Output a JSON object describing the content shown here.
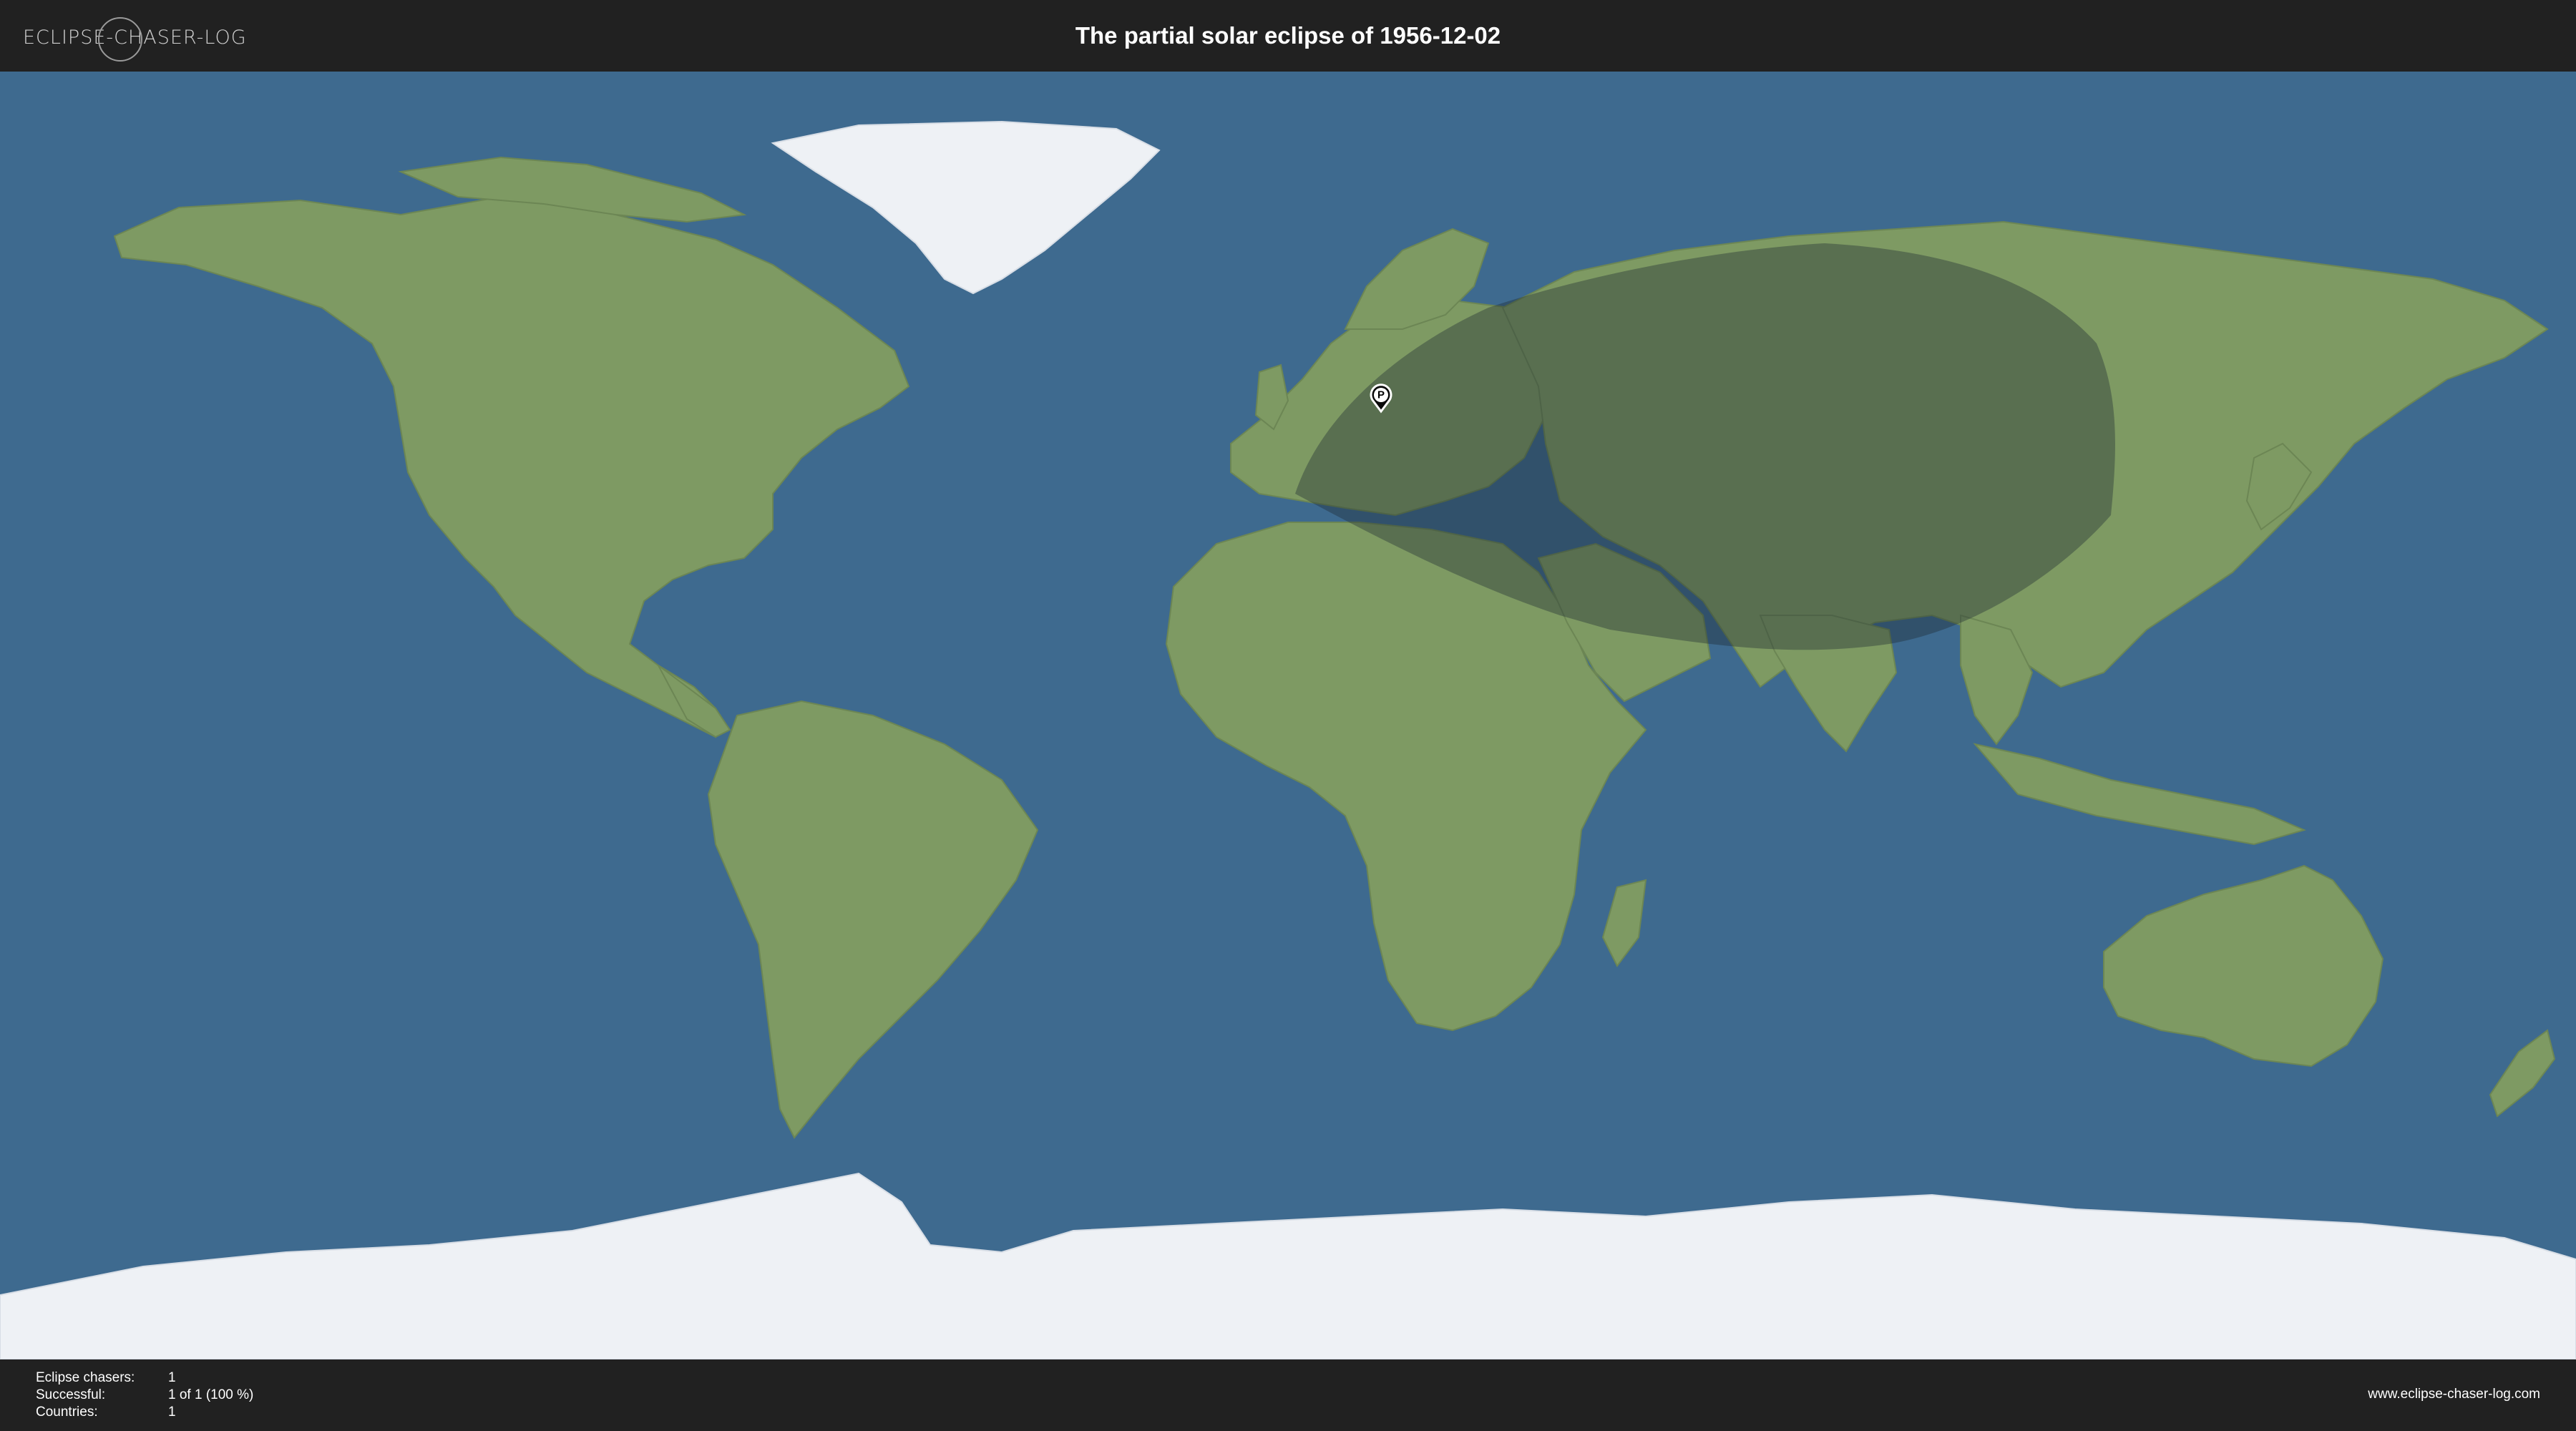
{
  "header": {
    "logo_text": "ECLIPSE-CHASER-LOG",
    "title": "The partial solar eclipse of 1956-12-02"
  },
  "map": {
    "projection": "equirectangular",
    "ocean_color": "#3e6a8f",
    "shadow_color": "#1e2a33",
    "observer_marker": {
      "label": "P",
      "lon": 13.0,
      "lat": 42.5
    }
  },
  "stats": [
    {
      "label": "Eclipse chasers:",
      "value": "1"
    },
    {
      "label": "Successful:",
      "value": "1 of 1 (100 %)"
    },
    {
      "label": "Countries:",
      "value": "1"
    }
  ],
  "footer": {
    "url": "www.eclipse-chaser-log.com"
  }
}
